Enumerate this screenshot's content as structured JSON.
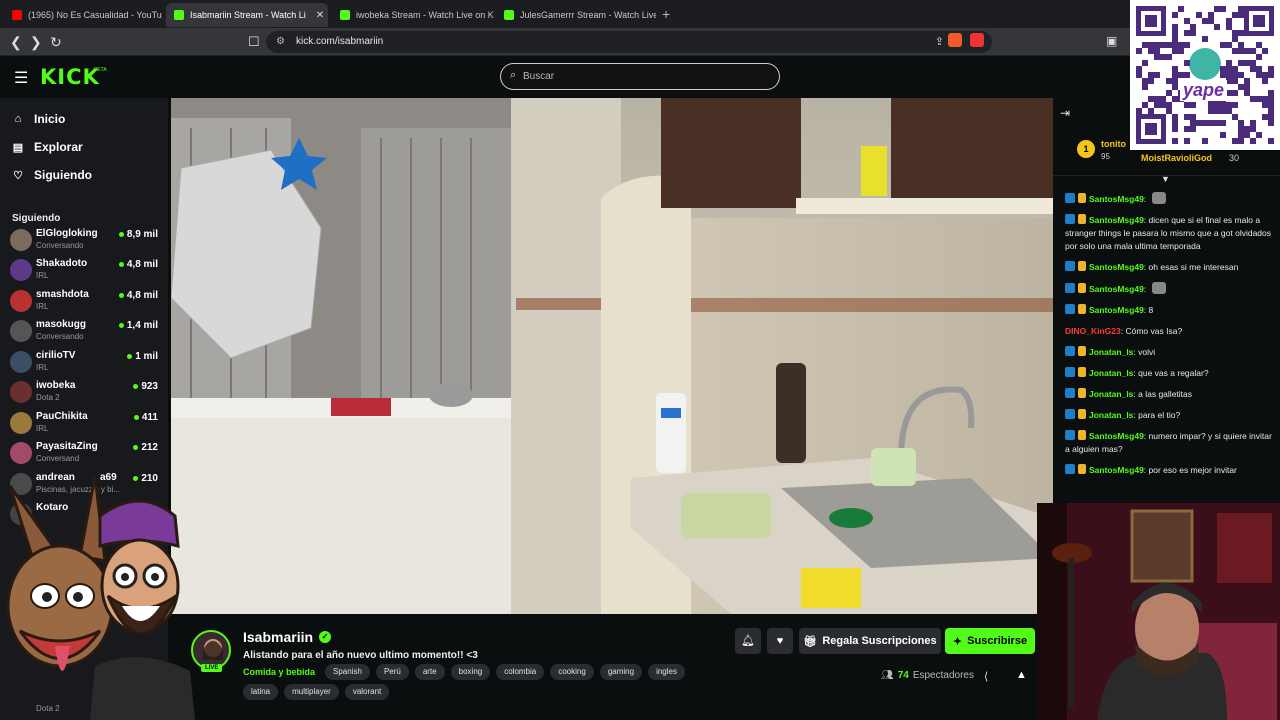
{
  "browser": {
    "tabs": [
      {
        "title": "(1965) No Es Casualidad - YouTu",
        "active": false
      },
      {
        "title": "Isabmariin Stream - Watch Li",
        "active": true
      },
      {
        "title": "iwobeka Stream - Watch Live on Kick",
        "active": false
      },
      {
        "title": "JulesGamerrr Stream - Watch Live on",
        "active": false
      }
    ],
    "new_tab": "+",
    "url": "kick.com/isabmariin"
  },
  "site": {
    "logo": "KICK",
    "beta": "BETA",
    "search_placeholder": "Buscar"
  },
  "sidebar": {
    "nav": [
      {
        "label": "Inicio",
        "icon": "home-icon"
      },
      {
        "label": "Explorar",
        "icon": "compass-icon"
      },
      {
        "label": "Siguiendo",
        "icon": "heart-icon"
      }
    ],
    "following_title": "Siguiendo",
    "channels": [
      {
        "name": "ElGlogloking",
        "category": "Conversando",
        "viewers": "8,9 mil",
        "color": "#7a6b5d"
      },
      {
        "name": "Shakadoto",
        "category": "IRL",
        "viewers": "4,8 mil",
        "color": "#5b3a8a"
      },
      {
        "name": "smashdota",
        "category": "IRL",
        "viewers": "4,8 mil",
        "color": "#b83232"
      },
      {
        "name": "masokugg",
        "category": "Conversando",
        "viewers": "1,4 mil",
        "color": "#555"
      },
      {
        "name": "cirilioTV",
        "category": "IRL",
        "viewers": "1 mil",
        "color": "#3b4e66"
      },
      {
        "name": "iwobeka",
        "category": "Dota 2",
        "viewers": "923",
        "color": "#6b2f2f"
      },
      {
        "name": "PauChikita",
        "category": "IRL",
        "viewers": "411",
        "color": "#9a7a3a"
      },
      {
        "name": "PayasitaZing",
        "category": "Conversand",
        "viewers": "212",
        "color": "#a34a6a"
      },
      {
        "name": "andrean",
        "nameSuffix": "a69",
        "category": "Piscinas, jacuzzis y bi...",
        "viewers": "210",
        "color": "#4a4a4a"
      },
      {
        "name": "Kotaro",
        "category": "",
        "viewers": "",
        "color": "#444"
      }
    ],
    "bottom_category": "Dota 2"
  },
  "stream": {
    "streamer": "Isabmariin",
    "live_badge": "LIVE",
    "title": "Alistando para el año nuevo ultimo momento!! <3",
    "category": "Comida y bebida",
    "tags": [
      "Spanish",
      "Perú",
      "arte",
      "boxing",
      "colombia",
      "cooking",
      "gaming",
      "ingles",
      "latina",
      "multiplayer",
      "valorant"
    ],
    "gift_label": "Regala Suscripciones",
    "subscribe_label": "Suscribirse",
    "viewers_count": "74",
    "viewers_label": "Espectadores"
  },
  "chat": {
    "pinned": {
      "rank": "1",
      "top_gifter": "tonito",
      "top_gifter_count": "95",
      "second_gifter": "MoistRavioliGod",
      "second_gifter_count": "30"
    },
    "messages": [
      {
        "user": "SantosMsg49",
        "text": "",
        "emote": true,
        "style": "u1",
        "badges": 2
      },
      {
        "user": "SantosMsg49",
        "text": "dicen que si el final es malo a stranger things le pasara lo mismo que a got olvidados por solo una mala ultima temporada",
        "emote": false,
        "style": "u1",
        "badges": 2
      },
      {
        "user": "SantosMsg49",
        "text": "oh esas si me interesan",
        "emote": false,
        "style": "u1",
        "badges": 2
      },
      {
        "user": "SantosMsg49",
        "text": "",
        "emote": true,
        "style": "u1",
        "badges": 2
      },
      {
        "user": "SantosMsg49",
        "text": "8",
        "emote": false,
        "style": "u1",
        "badges": 2
      },
      {
        "user": "DINO_KinG23",
        "text": "Cómo vas Isa?",
        "emote": false,
        "style": "u2",
        "badges": 0
      },
      {
        "user": "Jonatan_ls",
        "text": "volvi",
        "emote": false,
        "style": "u1",
        "badges": 2
      },
      {
        "user": "Jonatan_ls",
        "text": "que vas a regalar?",
        "emote": false,
        "style": "u1",
        "badges": 2
      },
      {
        "user": "Jonatan_ls",
        "text": "a las galletitas",
        "emote": false,
        "style": "u1",
        "badges": 2
      },
      {
        "user": "Jonatan_ls",
        "text": "para el tio?",
        "emote": false,
        "style": "u1",
        "badges": 2
      },
      {
        "user": "SantosMsg49",
        "text": "numero impar? y si quiere invitar a alguien mas?",
        "emote": false,
        "style": "u1",
        "badges": 2
      },
      {
        "user": "SantosMsg49",
        "text": "por eso es mejor invitar",
        "emote": false,
        "style": "u1",
        "badges": 2
      }
    ]
  },
  "overlay": {
    "qr_brand": "yape"
  }
}
